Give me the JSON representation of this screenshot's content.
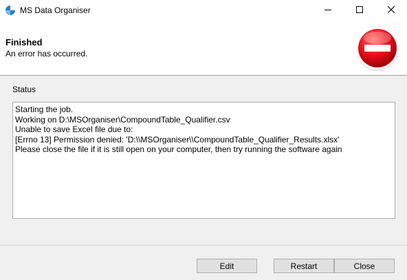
{
  "window": {
    "title": "MS Data Organiser",
    "app_icon": "app-logo-icon",
    "controls": {
      "minimize": "minimize-icon",
      "maximize": "maximize-icon",
      "close": "close-icon"
    }
  },
  "header": {
    "title": "Finished",
    "subtitle": "An error has occurred.",
    "status_icon": "error-stop-icon"
  },
  "status": {
    "label": "Status",
    "lines": [
      "Starting the job.",
      "Working on D:\\MSOrganiser\\CompoundTable_Qualifier.csv",
      "Unable to save Excel file due to:",
      "[Errno 13] Permission denied: 'D:\\\\MSOrganiser\\\\CompoundTable_Qualifier_Results.xlsx'",
      "Please close the file if it is still open on your computer, then try running the software again"
    ]
  },
  "buttons": {
    "edit": "Edit",
    "restart": "Restart",
    "close": "Close"
  },
  "colors": {
    "error_red": "#e8101a",
    "window_bg": "#f0f0f0",
    "panel_bg": "#ffffff",
    "button_bg": "#e1e1e1",
    "border": "#adadad"
  }
}
